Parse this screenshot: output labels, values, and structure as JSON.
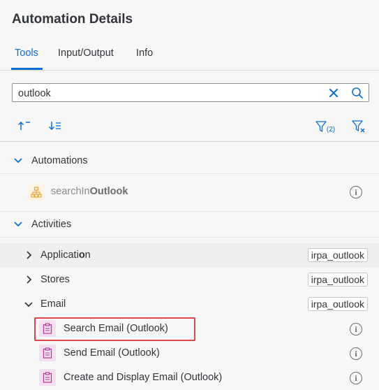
{
  "header": {
    "title": "Automation Details"
  },
  "tabs": [
    {
      "label": "Tools"
    },
    {
      "label": "Input/Output"
    },
    {
      "label": "Info"
    }
  ],
  "search": {
    "value": "outlook",
    "placeholder": ""
  },
  "toolbar": {
    "filter_count": "(2)"
  },
  "sections": {
    "automations": {
      "label": "Automations",
      "items": [
        {
          "prefix": "searchIn",
          "match": "Outlook"
        }
      ]
    },
    "activities": {
      "label": "Activities",
      "groups": [
        {
          "label_pre": "Applicati",
          "label_mid": "o",
          "label_post": "n",
          "badge": "irpa_outlook"
        },
        {
          "label": "Stores",
          "badge": "irpa_outlook"
        },
        {
          "label": "Email",
          "badge": "irpa_outlook"
        }
      ],
      "email_items": [
        {
          "label": "Search Email (Outlook)"
        },
        {
          "label": "Send Email (Outlook)"
        },
        {
          "label": "Create and Display Email (Outlook)"
        }
      ]
    }
  },
  "colors": {
    "accent": "#0a6ed1",
    "highlight": "#e0464b",
    "activity_icon": "#b0348f",
    "automation_icon": "#e8a33d"
  },
  "icons": {
    "sort_asc": "sort-ascending-icon",
    "sort_desc": "sort-descending-icon",
    "filter": "filter-icon",
    "clear_filter": "clear-filter-icon",
    "clear": "clear-icon",
    "search": "search-icon",
    "info": "info-icon"
  }
}
